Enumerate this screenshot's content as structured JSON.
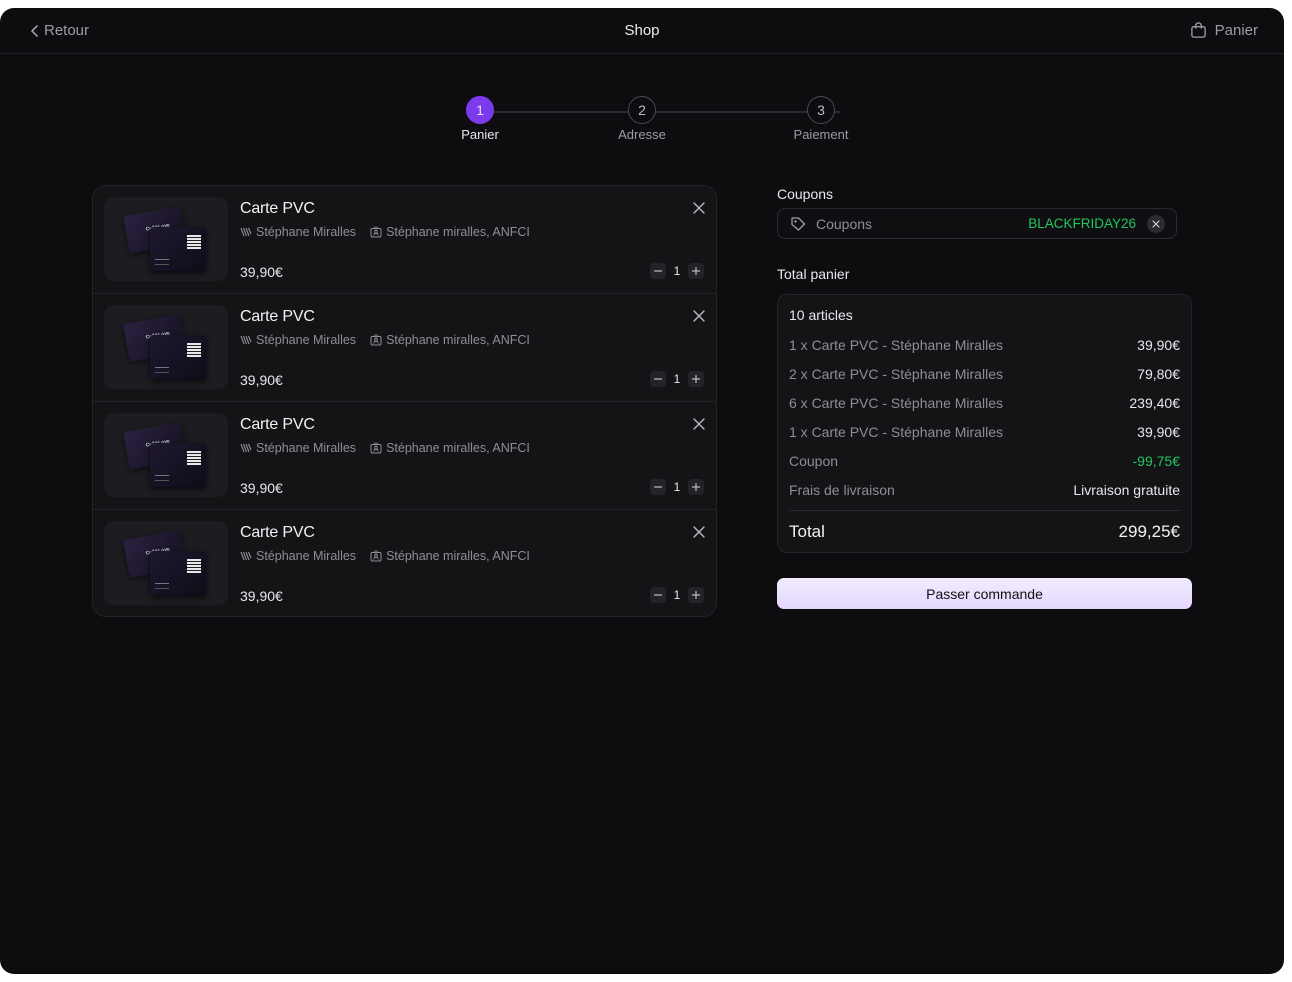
{
  "header": {
    "back_label": "Retour",
    "title": "Shop",
    "cart_label": "Panier"
  },
  "stepper": [
    {
      "number": "1",
      "label": "Panier",
      "active": true
    },
    {
      "number": "2",
      "label": "Adresse",
      "active": false
    },
    {
      "number": "3",
      "label": "Paiement",
      "active": false
    }
  ],
  "cart_items": [
    {
      "title": "Carte PVC",
      "brand": "Stéphane Miralles",
      "owner": "Stéphane miralles, ANFCI",
      "price": "39,90€",
      "quantity": "1",
      "card_text": "Cell&Love"
    },
    {
      "title": "Carte PVC",
      "brand": "Stéphane Miralles",
      "owner": "Stéphane miralles, ANFCI",
      "price": "39,90€",
      "quantity": "1",
      "card_text": "Cell&Love"
    },
    {
      "title": "Carte PVC",
      "brand": "Stéphane Miralles",
      "owner": "Stéphane miralles, ANFCI",
      "price": "39,90€",
      "quantity": "1",
      "card_text": "Cell&Love"
    },
    {
      "title": "Carte PVC",
      "brand": "Stéphane Miralles",
      "owner": "Stéphane miralles, ANFCI",
      "price": "39,90€",
      "quantity": "1",
      "card_text": "Cell&Love"
    }
  ],
  "coupons": {
    "section_label": "Coupons",
    "placeholder": "Coupons",
    "applied_code": "BLACKFRIDAY26"
  },
  "summary": {
    "section_label": "Total panier",
    "count_label": "10 articles",
    "rows": [
      {
        "label": "1 x Carte PVC - Stéphane Miralles",
        "value": "39,90€",
        "color": ""
      },
      {
        "label": "2 x Carte PVC - Stéphane Miralles",
        "value": "79,80€",
        "color": ""
      },
      {
        "label": "6 x Carte PVC - Stéphane Miralles",
        "value": "239,40€",
        "color": ""
      },
      {
        "label": "1 x Carte PVC - Stéphane Miralles",
        "value": "39,90€",
        "color": ""
      },
      {
        "label": "Coupon",
        "value": "-99,75€",
        "color": "#22c55e"
      },
      {
        "label": "Frais de livraison",
        "value": "Livraison gratuite",
        "color": ""
      }
    ],
    "total_label": "Total",
    "total_value": "299,25€"
  },
  "checkout_label": "Passer commande",
  "colors": {
    "accent": "#7c3aed",
    "success": "#22c55e",
    "background": "#0d0d10"
  }
}
